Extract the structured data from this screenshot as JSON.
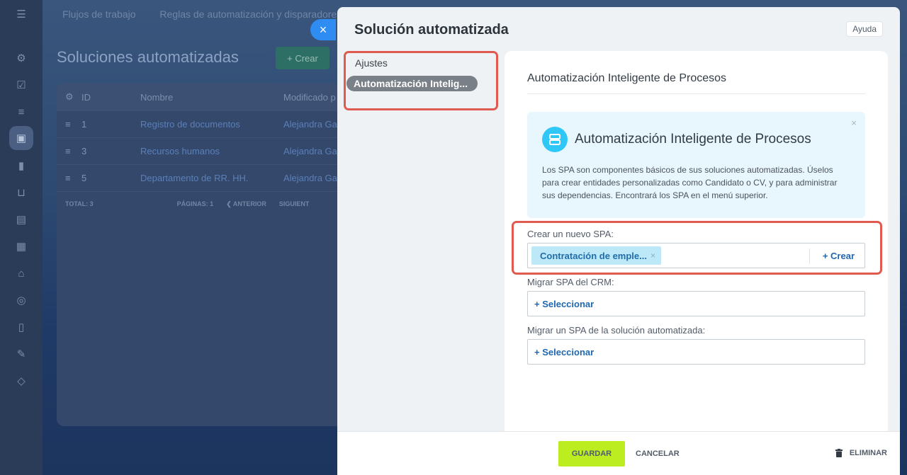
{
  "background": {
    "nav": [
      "Flujos de trabajo",
      "Reglas de automatización y disparadores"
    ],
    "page_title": "Soluciones automatizadas",
    "create_label": "+ Crear",
    "table": {
      "headers": [
        "ID",
        "Nombre",
        "Modificado p"
      ],
      "rows": [
        {
          "id": "1",
          "name": "Registro de documentos",
          "modified": "Alejandra Ga"
        },
        {
          "id": "3",
          "name": "Recursos humanos",
          "modified": "Alejandra Ga"
        },
        {
          "id": "5",
          "name": "Departamento de RR. HH.",
          "modified": "Alejandra Ga"
        }
      ],
      "footer": {
        "total": "TOTAL: 3",
        "pages": "PÁGINAS: 1",
        "prev": "❮ ANTERIOR",
        "next": "SIGUIENT"
      }
    }
  },
  "close_label": "×",
  "panel": {
    "title": "Solución automatizada",
    "help_label": "Ayuda",
    "menu": [
      {
        "label": "Ajustes"
      },
      {
        "label": "Automatización Intelig..."
      }
    ],
    "section_title": "Automatización Inteligente de Procesos",
    "info": {
      "title": "Automatización Inteligente de Procesos",
      "close": "×",
      "text": "Los SPA son componentes básicos de sus soluciones automatizadas. Úselos para crear entidades personalizadas como Candidato o CV, y para administrar sus dependencias. Encontrará los SPA en el menú superior."
    },
    "new_spa": {
      "label": "Crear un nuevo SPA:",
      "tag": "Contratación de emple...",
      "tag_remove": "×",
      "create": "+ Crear"
    },
    "migrate_crm": {
      "label": "Migrar SPA del CRM:",
      "select": "+ Seleccionar"
    },
    "migrate_solution": {
      "label": "Migrar un SPA de la solución automatizada:",
      "select": "+ Seleccionar"
    },
    "footer": {
      "save": "GUARDAR",
      "cancel": "CANCELAR",
      "delete": "ELIMINAR"
    }
  },
  "colors": {
    "accent_green": "#bbed21",
    "link_blue": "#2067b0",
    "highlight_red": "#e05a4f",
    "info_icon": "#2fc7f7"
  }
}
